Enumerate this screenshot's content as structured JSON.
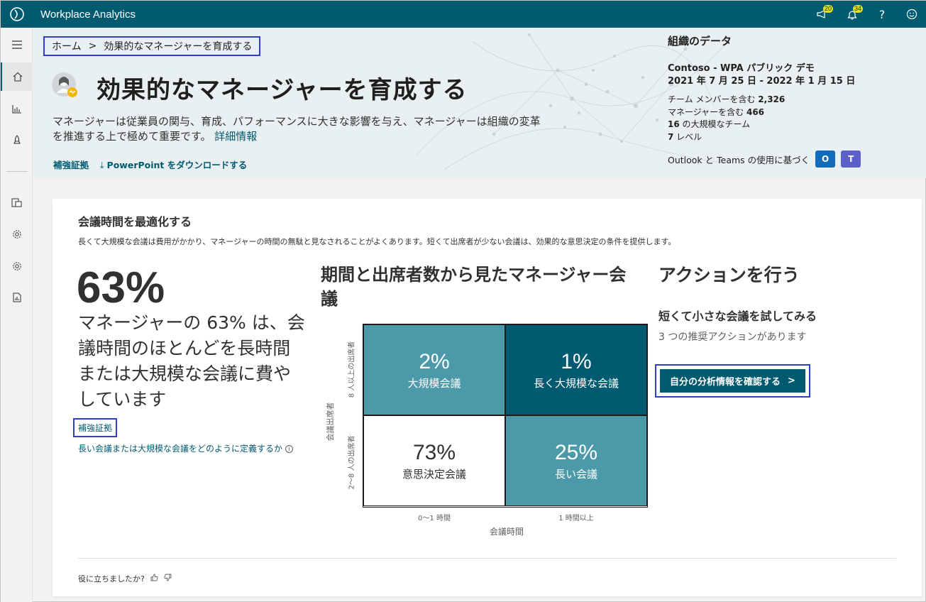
{
  "app": {
    "title": "Workplace Analytics"
  },
  "topbar": {
    "badge_left": "20",
    "badge_right": "34",
    "help": "?",
    "icons": [
      "megaphone-icon",
      "bell-icon",
      "help-icon",
      "smiley-icon"
    ]
  },
  "rail": {
    "icons": [
      "hamburger-icon",
      "home-icon",
      "chart-icon",
      "rocket-icon",
      "data-icon",
      "gear-icon",
      "settings-icon",
      "report-icon"
    ]
  },
  "breadcrumb": {
    "home": "ホーム",
    "sep": ">",
    "current": "効果的なマネージャーを育成する"
  },
  "hero": {
    "title": "効果的なマネージャーを育成する",
    "desc": "マネージャーは従業員の関与、育成、パフォーマンスに大きな影響を与え、マネージャーは組織の変革を推進する上で極めて重要です。",
    "desc_link": "詳細情報",
    "link_evidence": "補強証拠",
    "link_ppt": "PowerPoint をダウンロードする"
  },
  "org": {
    "title": "組織のデータ",
    "name": "Contoso - WPA パブリック デモ",
    "range": "2021 年 7 月 25 日 - 2022 年 1 月 15 日",
    "stat1_label": "チーム メンバーを含む ",
    "stat1_value": "2,326",
    "stat2_label": "マネージャーを含む ",
    "stat2_value": "466",
    "stat3_value": "16",
    "stat3_label": " の大規模なチーム",
    "stat4_value": "7",
    "stat4_label": " レベル",
    "source": "Outlook と Teams の使用に基づく",
    "colors": {
      "outlook": "#0f6cbd",
      "teams": "#5b5fc7"
    }
  },
  "card": {
    "title": "会議時間を最適化する",
    "desc": "長くて大規模な会議は費用がかかり、マネージャーの時間の無駄と見なされることがよくあります。短くて出席者が少ない会議は、効果的な意思決定の条件を提供します。",
    "big_pct": "63%",
    "big_text": "マネージャーの 63% は、会議時間のほとんどを長時間または大規模な会議に費やしています",
    "evidence": "補強証拠",
    "definition": "長い会議または大規模な会議をどのように定義するか",
    "info": "i"
  },
  "matrix": {
    "title": "期間と出席者数から見たマネージャー会議",
    "y_title": "会議出席者",
    "y_top": "8 人以上の出席者",
    "y_bottom": "2～8 人の出席者",
    "x_title": "会議時間",
    "x_left": "0～1 時間",
    "x_right": "1 時間以上",
    "cells": [
      {
        "pct": "2%",
        "label": "大規模会議"
      },
      {
        "pct": "1%",
        "label": "長く大規模な会議"
      },
      {
        "pct": "73%",
        "label": "意思決定会議"
      },
      {
        "pct": "25%",
        "label": "長い会議"
      }
    ],
    "colors": {
      "mid": "#4c9aa9",
      "dark": "#005a70",
      "white": "#ffffff"
    }
  },
  "action": {
    "title": "アクションを行う",
    "subtitle": "短くて小さな会議を試してみる",
    "count": "3 つの推奨アクションがあります",
    "button": "自分の分析情報を確認する",
    "chevron": ">"
  },
  "feedback": {
    "label": "役に立ちましたか?"
  }
}
